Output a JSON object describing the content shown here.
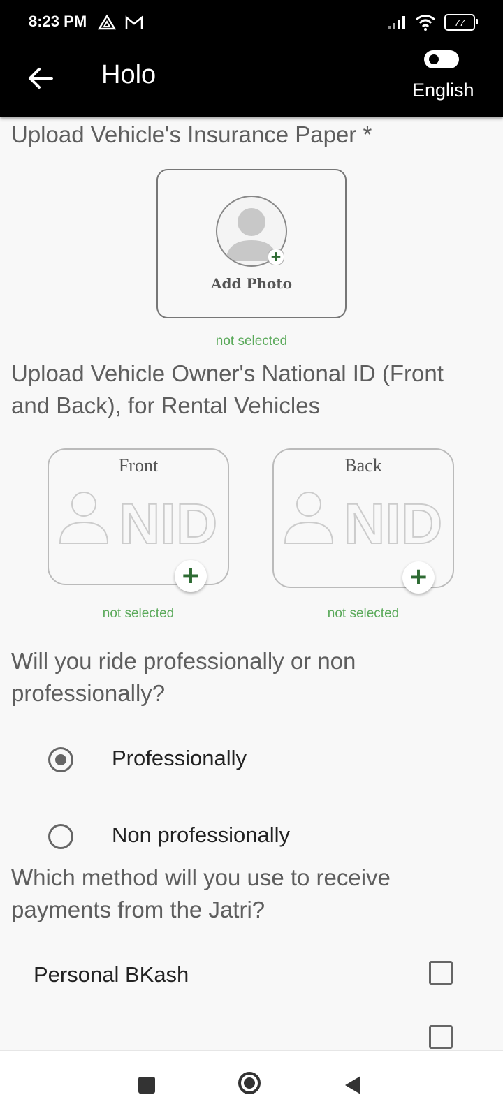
{
  "status_bar": {
    "time": "8:23 PM",
    "battery": "77"
  },
  "app_bar": {
    "title": "Holo",
    "language_label": "English"
  },
  "insurance": {
    "title": "Upload Vehicle's Insurance Paper *",
    "add_photo_label": "Add Photo",
    "status": "not selected"
  },
  "nid": {
    "title": "Upload Vehicle Owner's National ID (Front and Back), for Rental Vehicles",
    "front_label": "Front",
    "back_label": "Back",
    "front_status": "not selected",
    "back_status": "not selected",
    "card_text": "NID"
  },
  "ride_type": {
    "question": "Will you ride professionally or non professionally?",
    "options": [
      {
        "label": "Professionally",
        "selected": true
      },
      {
        "label": "Non professionally",
        "selected": false
      }
    ]
  },
  "payment": {
    "question": "Which method will you use to receive payments from the Jatri?",
    "options": [
      {
        "label": "Personal BKash",
        "checked": false
      }
    ]
  },
  "icons": {
    "back": "arrow-left-icon",
    "avatar": "person-placeholder-icon",
    "plus": "plus-icon",
    "nav_recent": "square-icon",
    "nav_home": "circle-icon",
    "nav_back": "triangle-back-icon"
  }
}
